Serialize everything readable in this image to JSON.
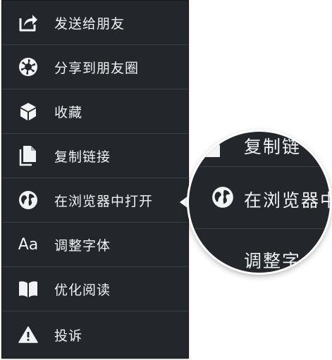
{
  "menu": {
    "items": [
      {
        "label": "发送给朋友",
        "icon": "share-arrow-icon"
      },
      {
        "label": "分享到朋友圈",
        "icon": "aperture-icon"
      },
      {
        "label": "收藏",
        "icon": "cube-icon"
      },
      {
        "label": "复制链接",
        "icon": "document-copy-icon"
      },
      {
        "label": "在浏览器中打开",
        "icon": "globe-icon"
      },
      {
        "label": "调整字体",
        "icon": "font-size-icon",
        "glyph": "Aa"
      },
      {
        "label": "优化阅读",
        "icon": "open-book-icon"
      },
      {
        "label": "投诉",
        "icon": "warning-icon"
      }
    ]
  },
  "magnifier": {
    "top_text": "复制链",
    "middle_text": "在浏览器中",
    "bottom_text": "调整字"
  },
  "colors": {
    "menu_background": "#23272b",
    "divider": "#3a3f44",
    "text": "#f2f3f4",
    "page_background": "#ffffff"
  }
}
